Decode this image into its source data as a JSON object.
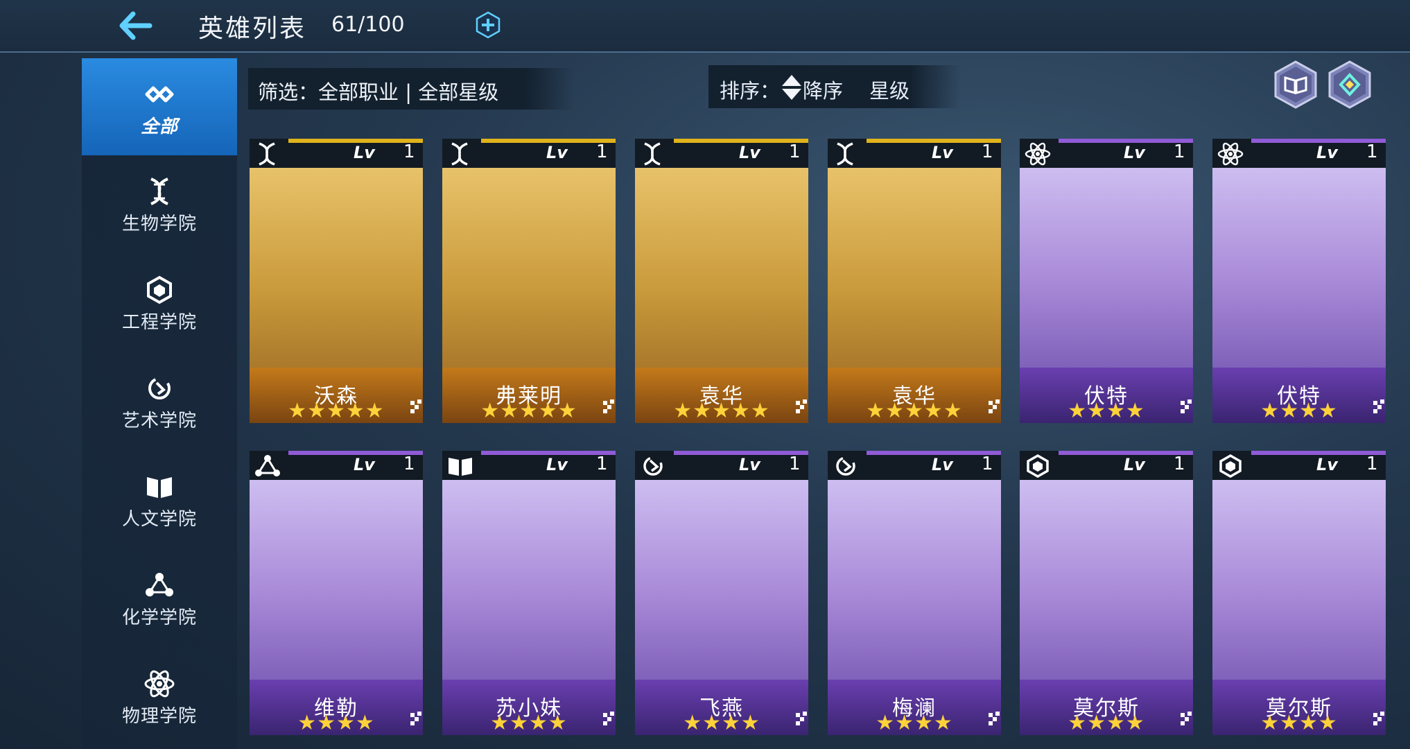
{
  "header": {
    "title": "英雄列表",
    "count": "61/100"
  },
  "sidebar": {
    "items": [
      {
        "label": "全部",
        "icon": "infinity-icon",
        "active": true
      },
      {
        "label": "生物学院",
        "icon": "dna-icon"
      },
      {
        "label": "工程学院",
        "icon": "engineering-icon"
      },
      {
        "label": "艺术学院",
        "icon": "art-icon"
      },
      {
        "label": "人文学院",
        "icon": "book-icon"
      },
      {
        "label": "化学学院",
        "icon": "molecule-icon"
      },
      {
        "label": "物理学院",
        "icon": "atom-icon"
      }
    ]
  },
  "filter": {
    "text": "筛选：全部职业 | 全部星级"
  },
  "sort": {
    "label": "排序：",
    "order": "降序",
    "key": "星级"
  },
  "toolbar": {
    "codex_icon": "book-hex-icon",
    "settings_icon": "diamond-hex-icon"
  },
  "colors": {
    "gold": "#d9a21f",
    "purple": "#8f5bd6",
    "accent": "#2a8be0",
    "star": "#ffd23a"
  },
  "lv_label": "Lv",
  "heroes": [
    {
      "name": "沃森",
      "level": "1",
      "stars": "★★★★★",
      "rarity": "gold",
      "class_icon": "dna-icon"
    },
    {
      "name": "弗莱明",
      "level": "1",
      "stars": "★★★★★",
      "rarity": "gold",
      "class_icon": "dna-icon"
    },
    {
      "name": "袁华",
      "level": "1",
      "stars": "★★★★★",
      "rarity": "gold",
      "class_icon": "dna-icon"
    },
    {
      "name": "袁华",
      "level": "1",
      "stars": "★★★★★",
      "rarity": "gold",
      "class_icon": "dna-icon"
    },
    {
      "name": "伏特",
      "level": "1",
      "stars": "★★★★",
      "rarity": "purple",
      "class_icon": "atom-icon"
    },
    {
      "name": "伏特",
      "level": "1",
      "stars": "★★★★",
      "rarity": "purple",
      "class_icon": "atom-icon"
    },
    {
      "name": "维勒",
      "level": "1",
      "stars": "★★★★",
      "rarity": "purple",
      "class_icon": "molecule-icon"
    },
    {
      "name": "苏小妹",
      "level": "1",
      "stars": "★★★★",
      "rarity": "purple",
      "class_icon": "book-icon"
    },
    {
      "name": "飞燕",
      "level": "1",
      "stars": "★★★★",
      "rarity": "purple",
      "class_icon": "art-icon"
    },
    {
      "name": "梅澜",
      "level": "1",
      "stars": "★★★★",
      "rarity": "purple",
      "class_icon": "art-icon"
    },
    {
      "name": "莫尔斯",
      "level": "1",
      "stars": "★★★★",
      "rarity": "purple",
      "class_icon": "engineering-icon"
    },
    {
      "name": "莫尔斯",
      "level": "1",
      "stars": "★★★★",
      "rarity": "purple",
      "class_icon": "engineering-icon"
    }
  ]
}
